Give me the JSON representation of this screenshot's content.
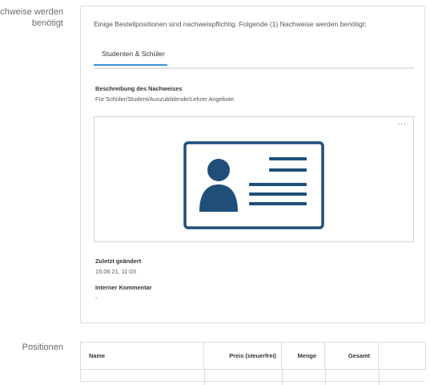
{
  "labels": {
    "nachweise": "Nachweise werden benötigt",
    "positionen": "Positionen"
  },
  "card": {
    "intro": "Einige Bestellpositionen sind nachweispflichtig. Folgende (1) Nachweise werden benötigt:",
    "tab": "Studenten & Schüler",
    "description_title": "Beschreibung des Nachweises",
    "description_text": "Für Schüler/Student/Auszubildende/Lehrer Angebote.",
    "image_menu": "···",
    "image_icon": "id-card-icon",
    "last_changed_title": "Zuletzt geändert",
    "last_changed_value": "15.06.21, 11:03",
    "comment_title": "Interner Kommentar",
    "comment_value": "-"
  },
  "table": {
    "headers": [
      "Name",
      "Preis (steuerfrei)",
      "Menge",
      "Gesamt",
      ""
    ]
  },
  "colors": {
    "accent": "#3a94d8",
    "icon": "#1f4e79"
  }
}
